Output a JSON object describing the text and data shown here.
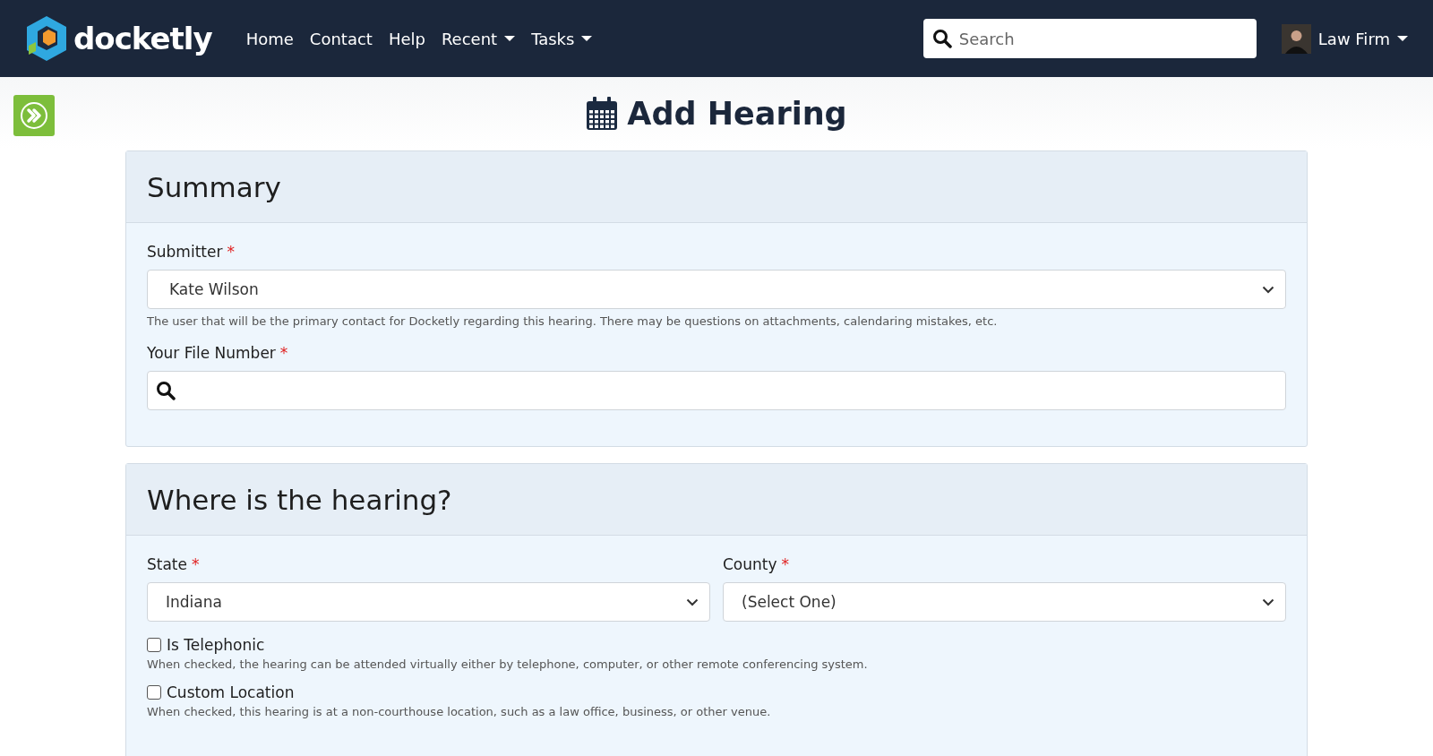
{
  "brand": {
    "name": "docketly"
  },
  "nav": [
    {
      "label": "Home",
      "dropdown": false
    },
    {
      "label": "Contact",
      "dropdown": false
    },
    {
      "label": "Help",
      "dropdown": false
    },
    {
      "label": "Recent",
      "dropdown": true
    },
    {
      "label": "Tasks",
      "dropdown": true
    }
  ],
  "search": {
    "placeholder": "Search"
  },
  "user": {
    "label": "Law Firm"
  },
  "page_title": "Add Hearing",
  "summary": {
    "heading": "Summary",
    "submitter": {
      "label": "Submitter",
      "required_mark": "*",
      "value": "Kate Wilson",
      "help": "The user that will be the primary contact for Docketly regarding this hearing. There may be questions on attachments, calendaring mistakes, etc."
    },
    "file_number": {
      "label": "Your File Number",
      "required_mark": "*"
    }
  },
  "location": {
    "heading": "Where is the hearing?",
    "selects": [
      {
        "label": "State",
        "required_mark": "*",
        "value": "Indiana"
      },
      {
        "label": "County",
        "required_mark": "*",
        "value": "(Select One)"
      }
    ],
    "options": [
      {
        "label": "Is Telephonic",
        "checked": false,
        "help": "When checked, the hearing can be attended virtually either by telephone, computer, or other remote conferencing system."
      },
      {
        "label": "Custom Location",
        "checked": false,
        "help": "When checked, this hearing is at a non-courthouse location, such as a law office, business, or other venue."
      }
    ]
  }
}
